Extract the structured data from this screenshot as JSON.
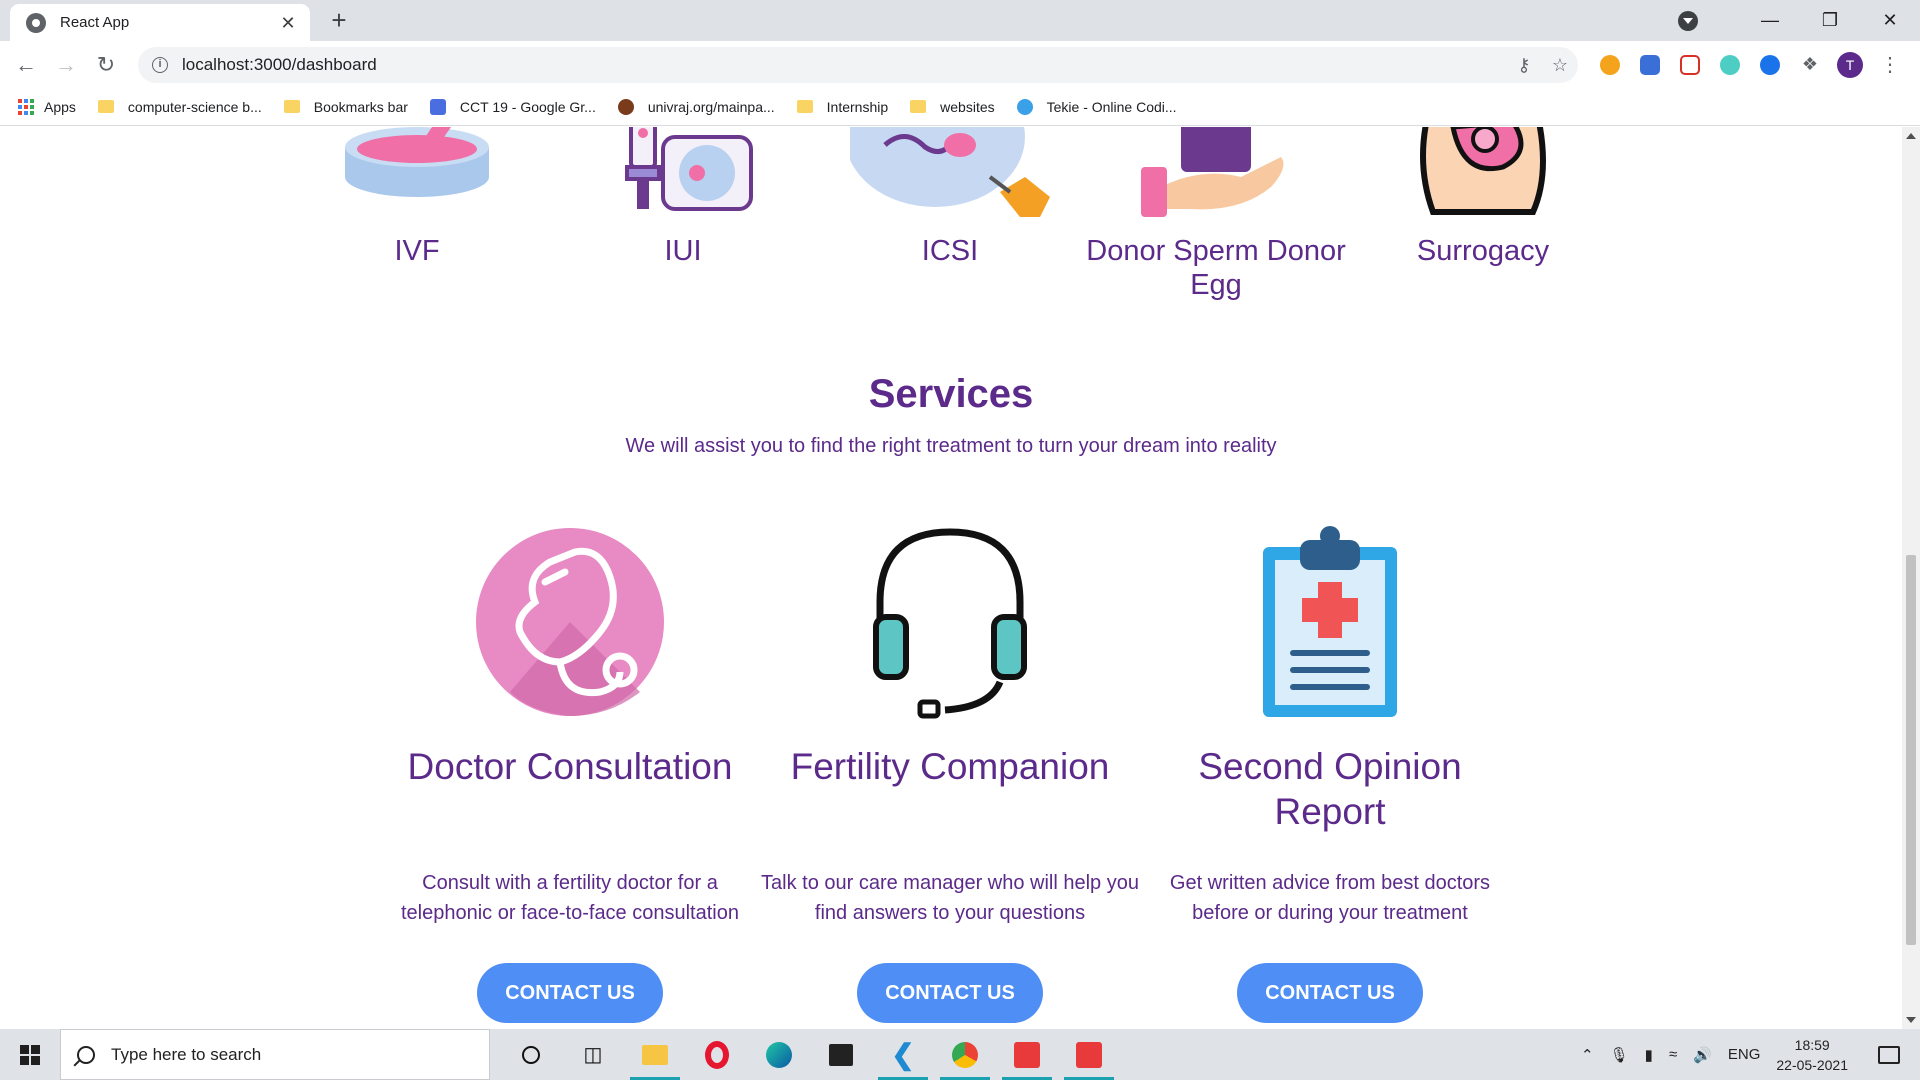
{
  "browser": {
    "tab_title": "React App",
    "tab_close": "✕",
    "new_tab": "+",
    "url": "localhost:3000/dashboard",
    "minimize": "—",
    "maximize": "❐",
    "close": "✕",
    "avatar_letter": "T"
  },
  "bookmarks": [
    {
      "label": "Apps",
      "kind": "apps"
    },
    {
      "label": "computer-science b...",
      "kind": "folder"
    },
    {
      "label": "Bookmarks bar",
      "kind": "folder"
    },
    {
      "label": "CCT 19 - Google Gr...",
      "kind": "site",
      "color": "#4a6ee0"
    },
    {
      "label": "univraj.org/mainpa...",
      "kind": "site",
      "color": "#7a3b1c"
    },
    {
      "label": "Internship",
      "kind": "folder"
    },
    {
      "label": "websites",
      "kind": "folder"
    },
    {
      "label": "Tekie - Online Codi...",
      "kind": "site",
      "color": "#3aa0e8"
    }
  ],
  "treatments": [
    {
      "label": "IVF"
    },
    {
      "label": "IUI"
    },
    {
      "label": "ICSI"
    },
    {
      "label": "Donor Sperm Donor Egg"
    },
    {
      "label": "Surrogacy"
    }
  ],
  "services": {
    "title": "Services",
    "subtitle": "We will assist you to find the right treatment to turn your dream into reality",
    "cards": [
      {
        "title": "Doctor Consultation",
        "description": "Consult with a fertility doctor for a telephonic or face-to-face consultation",
        "button": "CONTACT US",
        "icon": "stethoscope-icon"
      },
      {
        "title": "Fertility Companion",
        "description": "Talk to our care manager who will help you find answers to your questions",
        "button": "CONTACT US",
        "icon": "headset-icon"
      },
      {
        "title": "Second Opinion Report",
        "description": "Get written advice from best doctors before or during your treatment",
        "button": "CONTACT US",
        "icon": "clipboard-icon"
      }
    ]
  },
  "taskbar": {
    "search_placeholder": "Type here to search",
    "language": "ENG",
    "time": "18:59",
    "date": "22-05-2021"
  },
  "colors": {
    "brand_purple": "#5b2a8a",
    "button_blue": "#4f8ef5"
  }
}
